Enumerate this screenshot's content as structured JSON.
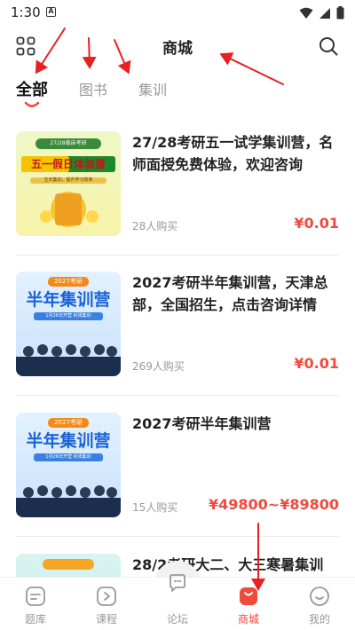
{
  "status": {
    "time": "1:30",
    "notice_icon": "A"
  },
  "header": {
    "title": "商城"
  },
  "tabs": [
    {
      "label": "全部",
      "active": true
    },
    {
      "label": "图书",
      "active": false
    },
    {
      "label": "集训",
      "active": false
    }
  ],
  "products": [
    {
      "title": "27/28考研五一试学集训营，名师面授免费体验，欢迎咨询",
      "buyers": "28人购买",
      "price": "¥0.01",
      "thumb": {
        "tag": "27/28临床考研",
        "heading": "五一假日体验营",
        "sub": "五天集训，提升学习效率"
      }
    },
    {
      "title": "2027考研半年集训营，天津总部，全国招生，点击咨询详情",
      "buyers": "269人购买",
      "price": "¥0.01",
      "thumb": {
        "tag": "2027考研",
        "heading": "半年集训营",
        "sub": "1月26日开营 封闭集训"
      }
    },
    {
      "title": "2027考研半年集训营",
      "buyers": "15人购买",
      "price": "¥49800~¥89800",
      "thumb": {
        "tag": "2027考研",
        "heading": "半年集训营",
        "sub": "1月26日开营 封闭集训"
      }
    },
    {
      "title": "28/2考研大二、大三寒暑集训",
      "buyers": "",
      "price": "",
      "thumb": {
        "tag": "",
        "heading": "",
        "sub": ""
      }
    }
  ],
  "bottom_nav": [
    {
      "label": "题库",
      "icon": "question-bank-icon",
      "active": false
    },
    {
      "label": "课程",
      "icon": "play-course-icon",
      "active": false
    },
    {
      "label": "论坛",
      "icon": "chat-bubble-icon",
      "active": false
    },
    {
      "label": "商城",
      "icon": "shop-bag-icon",
      "active": true
    },
    {
      "label": "我的",
      "icon": "profile-smile-icon",
      "active": false
    }
  ],
  "colors": {
    "accent": "#f04a3e",
    "muted": "#999999",
    "text": "#222222"
  }
}
